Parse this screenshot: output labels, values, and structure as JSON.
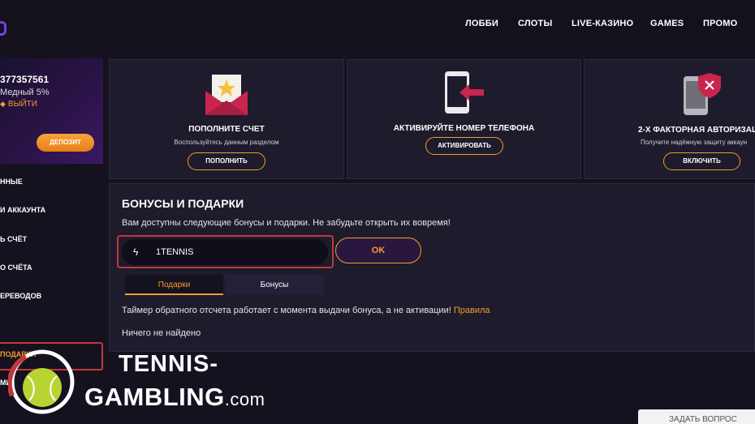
{
  "header": {
    "nav": [
      {
        "label": "ЛОББИ"
      },
      {
        "label": "СЛОТЫ"
      },
      {
        "label": "LIVE-КАЗИНО"
      },
      {
        "label": "GAMES"
      },
      {
        "label": "ПРОМО"
      }
    ]
  },
  "sidebar": {
    "user_id": "377357561",
    "level": "Медный 5%",
    "logout_label": "ВЫЙТИ",
    "deposit_label": "ДЕПОЗИТ",
    "items": [
      {
        "label": "ННЫЕ"
      },
      {
        "label": "И АККАУНТА"
      },
      {
        "label": "Ь СЧЁТ"
      },
      {
        "label": "О СЧЁТА"
      },
      {
        "label": "ЕРЕВОДОВ"
      },
      {
        "label": "ПОДАРКИ",
        "active": true
      },
      {
        "label": "МИ"
      }
    ]
  },
  "cards": [
    {
      "title": "ПОПОЛНИТЕ СЧЕТ",
      "subtitle": "Воспользуйтесь данным разделом",
      "button": "ПОПОЛНИТЬ",
      "icon": "envelope-star-icon"
    },
    {
      "title": "АКТИВИРУЙТЕ НОМЕР ТЕЛЕФОНА",
      "subtitle": "",
      "button": "АКТИВИРОВАТЬ",
      "icon": "phone-arrow-icon"
    },
    {
      "title": "2-Х ФАКТОРНАЯ АВТОРИЗАЦ",
      "subtitle": "Получите надёжную защиту аккаун",
      "button": "ВКЛЮЧИТЬ",
      "icon": "phone-shield-icon"
    }
  ],
  "bonus_panel": {
    "title": "БОНУСЫ И ПОДАРКИ",
    "note": "Вам доступны следующие бонусы и подарки. Не забудьте открыть их вовремя!",
    "promo_value": "1TENNIS",
    "ok_label": "OK",
    "tabs": [
      {
        "label": "Подарки",
        "active": true
      },
      {
        "label": "Бонусы",
        "active": false
      }
    ],
    "timer_text": "Таймер обратного отсчета работает с момента выдачи бонуса, а не активации!",
    "rules_link": "Правила",
    "empty_text": "Ничего не найдено"
  },
  "support": {
    "ask_label": "ЗАДАТЬ ВОПРОС"
  },
  "watermark": {
    "line1": "TENNIS-",
    "line2": "GAMBLING",
    "suffix": ".com"
  },
  "colors": {
    "accent": "#f39c2e",
    "highlight_frame": "#c0383c",
    "panel": "#1e1b2c",
    "background": "#15121f",
    "brand_purple": "#7b3cf0"
  }
}
